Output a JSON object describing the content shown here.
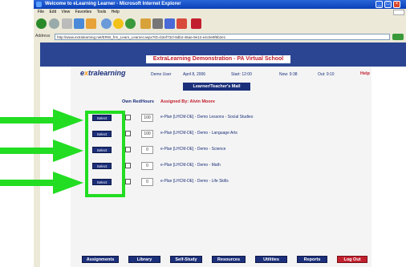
{
  "browser": {
    "title": "Welcome to eLearning Learner - Microsoft Internet Explorer",
    "menu": [
      "File",
      "Edit",
      "View",
      "Favorites",
      "Tools",
      "Help"
    ],
    "address_label": "Address",
    "address": "http://www.extralearning.net/ERW_frm_Learn_Learner.aspx?ID=b2ef73cf-9db4-46ae-9e12-e4c0e9f6b2e1",
    "links_label": "Links"
  },
  "page": {
    "banner_title": "ExtraLearning Demonstration - PA Virtual School",
    "logo_prefix": "e",
    "logo_x": "x",
    "logo_suffix": "tralearning",
    "header": {
      "user": "Demo User",
      "date": "April 8, 2006",
      "start": "Start: 12:00",
      "time_now": "Now: 9:38",
      "time_out": "Out: 9:10"
    },
    "help": "Help",
    "learner_button": "Learner/Teacher's Mail",
    "columns": {
      "own_red": "Own Red",
      "hours": "Hours",
      "assigned": "Assigned By: Alvin Moore"
    },
    "rows": [
      {
        "select": "Select",
        "hours": "100",
        "desc": "e-Plan [LHCM-DE] - Demo Lessons - Social Studies"
      },
      {
        "select": "Select",
        "hours": "100",
        "desc": "e-Plan [LHCM-DE] - Demo - Language Arts"
      },
      {
        "select": "Select",
        "hours": "0",
        "desc": "e-Plan [LHCM-DE] - Demo - Science"
      },
      {
        "select": "Select",
        "hours": "0",
        "desc": "e-Plan [LHCM-DE] - Demo - Math"
      },
      {
        "select": "Select",
        "hours": "0",
        "desc": "e-Plan [LHCM-DE] - Demo - Life Skills"
      }
    ],
    "bottom_nav": [
      "Assignments",
      "Library",
      "Self-Study",
      "Resources",
      "Utilities",
      "Reports",
      "Log Out"
    ]
  },
  "colors": {
    "banner": "#2b4592",
    "nav_blue": "#1b2f7a",
    "accent_red": "#c2202e",
    "highlight": "#22dd22",
    "arrow": "#22dd22"
  }
}
